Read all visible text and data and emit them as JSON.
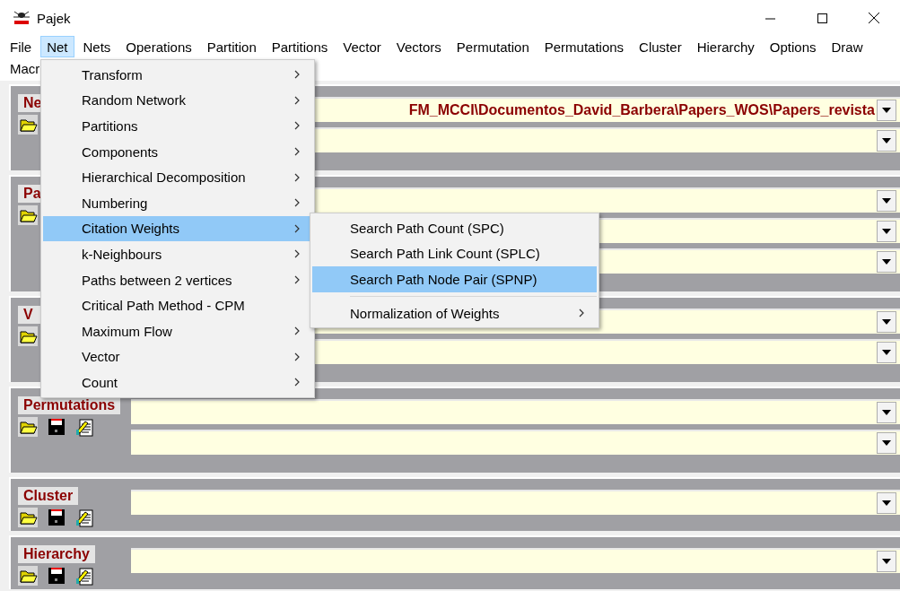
{
  "window": {
    "title": "Pajek"
  },
  "menu_bar": [
    {
      "label": "File",
      "selected": false
    },
    {
      "label": "Net",
      "selected": true
    },
    {
      "label": "Nets",
      "selected": false
    },
    {
      "label": "Operations",
      "selected": false
    },
    {
      "label": "Partition",
      "selected": false
    },
    {
      "label": "Partitions",
      "selected": false
    },
    {
      "label": "Vector",
      "selected": false
    },
    {
      "label": "Vectors",
      "selected": false
    },
    {
      "label": "Permutation",
      "selected": false
    },
    {
      "label": "Permutations",
      "selected": false
    },
    {
      "label": "Cluster",
      "selected": false
    },
    {
      "label": "Hierarchy",
      "selected": false
    },
    {
      "label": "Options",
      "selected": false
    },
    {
      "label": "Draw",
      "selected": false
    },
    {
      "label": "Macr",
      "selected": false
    }
  ],
  "sections": [
    {
      "title": "Ne",
      "icons": [
        {
          "kind": "open"
        }
      ],
      "combos": [
        {
          "kind": "dropdown",
          "value": "FM_MCCI\\Documentos_David_Barbera\\Papers_WOS\\Papers_revista"
        },
        {
          "kind": "dropdown"
        }
      ]
    },
    {
      "title": "Pa",
      "icons": [
        {
          "kind": "open"
        }
      ],
      "combos": [
        {
          "kind": "dropdown"
        },
        {
          "kind": "dropdown"
        },
        {
          "kind": "dropdown"
        }
      ]
    },
    {
      "title": "V",
      "icons": [
        {
          "kind": "open"
        }
      ],
      "combos": [
        {
          "kind": "dropdown"
        },
        {
          "kind": "dropdown"
        }
      ]
    },
    {
      "title": "Permutations",
      "icons": [
        {
          "kind": "open"
        },
        {
          "kind": "save"
        },
        {
          "kind": "edit"
        }
      ],
      "combos": [
        {
          "kind": "dropdown"
        },
        {
          "kind": "dropdown"
        }
      ]
    },
    {
      "title": "Cluster",
      "icons": [
        {
          "kind": "open"
        },
        {
          "kind": "save"
        },
        {
          "kind": "edit"
        }
      ],
      "combos": [
        {
          "kind": "dropdown"
        }
      ]
    },
    {
      "title": "Hierarchy",
      "icons": [
        {
          "kind": "open"
        },
        {
          "kind": "save"
        },
        {
          "kind": "edit"
        }
      ],
      "combos": [
        {
          "kind": "dropdown"
        }
      ]
    }
  ],
  "net_menu": [
    {
      "label": "Transform",
      "submenu": true,
      "selected": false
    },
    {
      "label": "Random Network",
      "submenu": true,
      "selected": false
    },
    {
      "label": "Partitions",
      "submenu": true,
      "selected": false
    },
    {
      "label": "Components",
      "submenu": true,
      "selected": false
    },
    {
      "label": "Hierarchical Decomposition",
      "submenu": true,
      "selected": false
    },
    {
      "label": "Numbering",
      "submenu": true,
      "selected": false
    },
    {
      "label": "Citation Weights",
      "submenu": true,
      "selected": true
    },
    {
      "label": "k-Neighbours",
      "submenu": true,
      "selected": false
    },
    {
      "label": "Paths between 2 vertices",
      "submenu": true,
      "selected": false
    },
    {
      "label": "Critical Path Method - CPM",
      "submenu": false,
      "selected": false
    },
    {
      "label": "Maximum Flow",
      "submenu": true,
      "selected": false
    },
    {
      "label": "Vector",
      "submenu": true,
      "selected": false
    },
    {
      "label": "Count",
      "submenu": true,
      "selected": false
    }
  ],
  "citation_weights_menu": [
    {
      "kind": "item",
      "label": "Search Path Count (SPC)",
      "submenu": false,
      "selected": false
    },
    {
      "kind": "item",
      "label": "Search Path Link Count (SPLC)",
      "submenu": false,
      "selected": false
    },
    {
      "kind": "item",
      "label": "Search Path Node Pair (SPNP)",
      "submenu": false,
      "selected": true
    },
    {
      "kind": "separator"
    },
    {
      "kind": "item",
      "label": "Normalization of Weights",
      "submenu": true,
      "selected": false
    }
  ]
}
